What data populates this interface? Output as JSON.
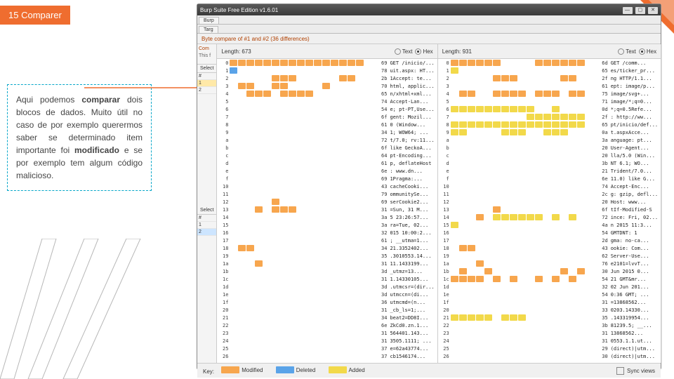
{
  "slide_badge": "15 Comparer",
  "annot_html": "Aqui podemos <b>comparar</b> dois blocos de dados. Muito útil no caso de por exemplo querermos saber se determinado item importante foi <b>modificado</b> e se por exemplo tem algum código malicioso.",
  "window": {
    "title": "Burp Suite Free Edition v1.6.01",
    "tabs": [
      "Burp"
    ],
    "tabs2": [
      "Targ"
    ],
    "subtab": "Byte compare of #1 and #2  (36 differences)",
    "left_hdr": "Com",
    "left_sub": "This f",
    "left_sel": "Select",
    "left_rows": [
      [
        "#",
        ""
      ],
      [
        "1",
        ""
      ],
      [
        "2",
        ""
      ]
    ],
    "left_sel2": "Select",
    "left_rows2": [
      [
        "#",
        ""
      ],
      [
        "1",
        ""
      ],
      [
        "2",
        ""
      ]
    ]
  },
  "panes": {
    "left": {
      "length_label": "Length: 673",
      "radio": [
        "Text",
        "Hex"
      ],
      "sel": 1
    },
    "right": {
      "length_label": "Length: 931",
      "radio": [
        "Text",
        "Hex"
      ],
      "sel": 1
    }
  },
  "key": {
    "label": "Key:",
    "modified": "Modified",
    "deleted": "Deleted",
    "added": "Added",
    "sync": "Sync views"
  },
  "rows_left": [
    {
      "o": "0",
      "p": "mmmmmmmmmmmmmmmm",
      "v": "69",
      "t": "GET /inicio/..."
    },
    {
      "o": "1",
      "p": "d...............",
      "v": "78",
      "t": "uit.aspx: HT..."
    },
    {
      "o": "2",
      "p": ".....mmm.....mm.",
      "v": "2b",
      "t": "1Accept: te..."
    },
    {
      "o": "3",
      "p": ".mm..mm....m....",
      "v": "70",
      "t": "html, applic..."
    },
    {
      "o": "4",
      "p": "..mmm.mmmm......",
      "v": "65",
      "t": "n/xhtml+xml..."
    },
    {
      "o": "5",
      "p": "................",
      "v": "74",
      "t": "Accept-Lan..."
    },
    {
      "o": "6",
      "p": "................",
      "v": "54",
      "t": "e; pt-PT,Use..."
    },
    {
      "o": "7",
      "p": "................",
      "v": "6f",
      "t": "gent: Mozil..."
    },
    {
      "o": "8",
      "p": "................",
      "v": "61",
      "t": "0 (Window..."
    },
    {
      "o": "9",
      "p": "................",
      "v": "34",
      "t": "1; WOW64; ..."
    },
    {
      "o": "a",
      "p": "................",
      "v": "72",
      "t": "t/7.0; rv:11..."
    },
    {
      "o": "b",
      "p": "................",
      "v": "6f",
      "t": "like GeckoA..."
    },
    {
      "o": "c",
      "p": "................",
      "v": "64",
      "t": "pt-Encoding..."
    },
    {
      "o": "d",
      "p": "................",
      "v": "61",
      "t": "p, deflateHost"
    },
    {
      "o": "e",
      "p": "................",
      "v": "6e",
      "t": ": www.dn..."
    },
    {
      "o": "f",
      "p": "................",
      "v": "69",
      "t": "1Pragma:..."
    },
    {
      "o": "10",
      "p": "................",
      "v": "43",
      "t": "cacheCooki..."
    },
    {
      "o": "11",
      "p": "................",
      "v": "79",
      "t": "ommunitySe..."
    },
    {
      "o": "12",
      "p": ".....m..........",
      "v": "69",
      "t": "serCookie2..."
    },
    {
      "o": "13",
      "p": "...m.mmm........",
      "v": "31",
      "t": "=Sun, 31 M..."
    },
    {
      "o": "14",
      "p": "................",
      "v": "3a",
      "t": "5 23:26:57..."
    },
    {
      "o": "15",
      "p": "................",
      "v": "3a",
      "t": "ra=Tue, 02..."
    },
    {
      "o": "16",
      "p": "................",
      "v": "32",
      "t": "015 10:00:2..."
    },
    {
      "o": "17",
      "p": "................",
      "v": "61",
      "t": "; __utma=1..."
    },
    {
      "o": "18",
      "p": ".mm.............",
      "v": "34",
      "t": "21.3352402..."
    },
    {
      "o": "19",
      "p": "................",
      "v": "35",
      "t": ".3010553.14..."
    },
    {
      "o": "1a",
      "p": "...m............",
      "v": "31",
      "t": "11.1433199..."
    },
    {
      "o": "1b",
      "p": "................",
      "v": "3d",
      "t": "_utmz=13..."
    },
    {
      "o": "1c",
      "p": "................",
      "v": "31",
      "t": "1.14330105..."
    },
    {
      "o": "1d",
      "p": "................",
      "v": "3d",
      "t": ".utmcsr=(dir..."
    },
    {
      "o": "1e",
      "p": "................",
      "v": "3d",
      "t": "utmccn=(di..."
    },
    {
      "o": "1f",
      "p": "................",
      "v": "36",
      "t": "utmcmd=(n..."
    },
    {
      "o": "20",
      "p": "................",
      "v": "31",
      "t": "_cb_ls=1;..."
    },
    {
      "o": "21",
      "p": "................",
      "v": "34",
      "t": "beat2=DD8I..."
    },
    {
      "o": "22",
      "p": "................",
      "v": "6e",
      "t": "ZkCd0.zn.1..."
    },
    {
      "o": "23",
      "p": "................",
      "v": "31",
      "t": "564401.143..."
    },
    {
      "o": "24",
      "p": "................",
      "v": "31",
      "t": "3505.1111; ..."
    },
    {
      "o": "25",
      "p": "................",
      "v": "37",
      "t": "e=62a43774..."
    },
    {
      "o": "26",
      "p": "................",
      "v": "37",
      "t": "cb1546174..."
    }
  ],
  "rows_right": [
    {
      "o": "0",
      "p": "mmmmmm....mmmmmm",
      "v": "6d",
      "t": "GET /comm..."
    },
    {
      "o": "1",
      "p": "a...............",
      "v": "65",
      "t": "es/ticker_pr..."
    },
    {
      "o": "2",
      "p": ".....mmm.....mm.",
      "v": "2f",
      "t": "ng HTTP/1.1..."
    },
    {
      "o": "3",
      "p": "................",
      "v": "61",
      "t": "ept: image/p..."
    },
    {
      "o": "4",
      "p": ".mm..mmmm.mmm.mm",
      "v": "75",
      "t": "image/svg+..."
    },
    {
      "o": "5",
      "p": "................",
      "v": "71",
      "t": "image/*;q=0..."
    },
    {
      "o": "6",
      "p": "aaaaaaaaaa..a...",
      "v": "0d",
      "t": "*;q=0.5Refe..."
    },
    {
      "o": "7",
      "p": ".........aaaaaaa",
      "v": "2f",
      "t": ": http://ww..."
    },
    {
      "o": "8",
      "p": "aaaaaaaaaaaaaaaa",
      "v": "65",
      "t": "pt/inicio/def..."
    },
    {
      "o": "9",
      "p": "aa....aaa..aaa..",
      "v": "0a",
      "t": "t.aspxAcce..."
    },
    {
      "o": "a",
      "p": "................",
      "v": "3a",
      "t": "anguage: pt..."
    },
    {
      "o": "b",
      "p": "................",
      "v": "20",
      "t": "User-Agent..."
    },
    {
      "o": "c",
      "p": "................",
      "v": "20",
      "t": "lla/5.0 (Win..."
    },
    {
      "o": "d",
      "p": "................",
      "v": "3b",
      "t": "NT 6.1; WO..."
    },
    {
      "o": "e",
      "p": "................",
      "v": "21",
      "t": "Trident/7.0..."
    },
    {
      "o": "f",
      "p": "................",
      "v": "6e",
      "t": "11.0) like G..."
    },
    {
      "o": "10",
      "p": "................",
      "v": "74",
      "t": "Accept-Enc..."
    },
    {
      "o": "11",
      "p": "................",
      "v": "2c",
      "t": "g: gzip, defl..."
    },
    {
      "o": "12",
      "p": "................",
      "v": "20",
      "t": "Host: www..."
    },
    {
      "o": "13",
      "p": ".....m..........",
      "v": "6f",
      "t": "tIf-Modified-S"
    },
    {
      "o": "14",
      "p": "...m.aaaaaa.a.a.",
      "v": "72",
      "t": "ince: Fri, 02..."
    },
    {
      "o": "15",
      "p": "a...............",
      "v": "4a",
      "t": "n 2015 11:3..."
    },
    {
      "o": "16",
      "p": "................",
      "v": "54",
      "t": "GMTDNT: 1"
    },
    {
      "o": "17",
      "p": "................",
      "v": "2d",
      "t": "gma: no-ca..."
    },
    {
      "o": "18",
      "p": ".mm.............",
      "v": "43",
      "t": "ookie: Com..."
    },
    {
      "o": "19",
      "p": "................",
      "v": "62",
      "t": "Server-Use..."
    },
    {
      "o": "1a",
      "p": "...m............",
      "v": "76",
      "t": "e2101=lvvT..."
    },
    {
      "o": "1b",
      "p": ".m..m........m.m",
      "v": "30",
      "t": "Jun 2015 0..."
    },
    {
      "o": "1c",
      "p": "mmmm.m.m..m.m.m.",
      "v": "54",
      "t": "21 GMT&mr..."
    },
    {
      "o": "1d",
      "p": "................",
      "v": "32",
      "t": "02 Jun 201..."
    },
    {
      "o": "1e",
      "p": "................",
      "v": "54",
      "t": "0:36 GMT; ..."
    },
    {
      "o": "1f",
      "p": "................",
      "v": "31",
      "t": "=13868562..."
    },
    {
      "o": "20",
      "p": "................",
      "v": "33",
      "t": "0203.14330..."
    },
    {
      "o": "21",
      "p": "aaaaa.aaa.......",
      "v": "35",
      "t": ".143319954..."
    },
    {
      "o": "22",
      "p": "................",
      "v": "3b",
      "t": "81239.5; __..."
    },
    {
      "o": "23",
      "p": "................",
      "v": "31",
      "t": "13868562..."
    },
    {
      "o": "24",
      "p": "................",
      "v": "31",
      "t": "0553.1.1.ut..."
    },
    {
      "o": "25",
      "p": "................",
      "v": "29",
      "t": "(direct)|utm..."
    },
    {
      "o": "26",
      "p": "................",
      "v": "30",
      "t": "(direct)|utm..."
    }
  ]
}
